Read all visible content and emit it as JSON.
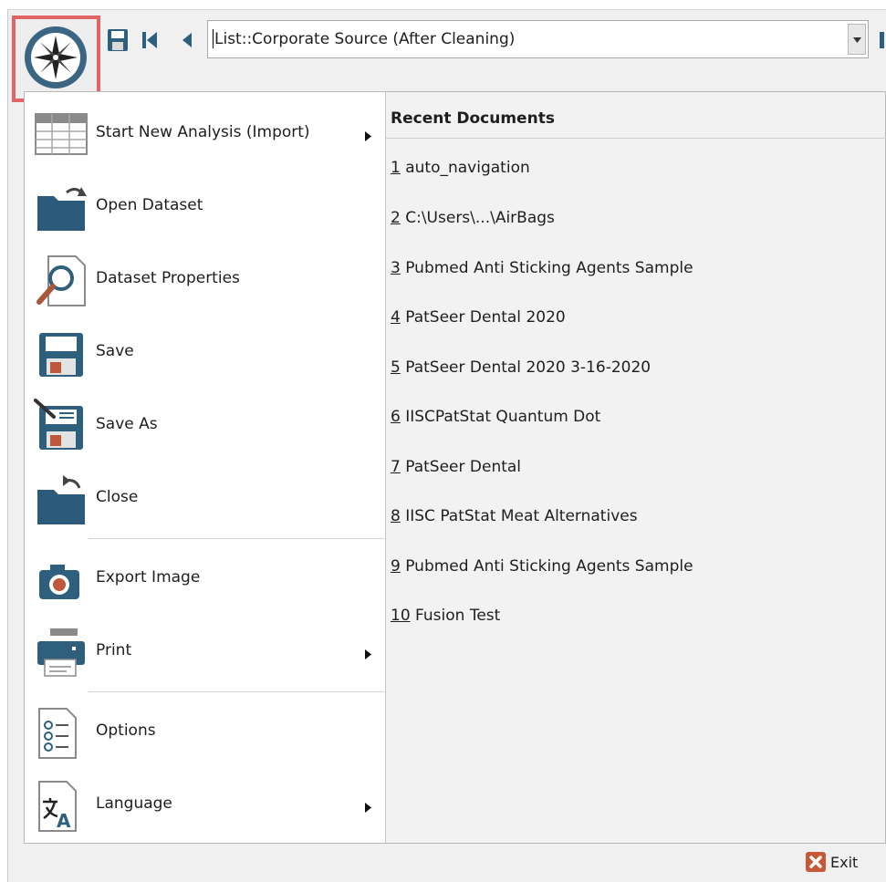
{
  "toolbar": {
    "source_value": "List::Corporate Source (After Cleaning)",
    "icons": [
      "compass-icon",
      "save-icon",
      "first-record-icon",
      "previous-record-icon",
      "dropdown-arrow-icon",
      "next-record-icon"
    ]
  },
  "menu": {
    "items": [
      {
        "label": "Start New Analysis (Import)",
        "icon": "table-icon",
        "submenu": true
      },
      {
        "label": "Open Dataset",
        "icon": "open-folder-icon",
        "submenu": false
      },
      {
        "label": "Dataset Properties",
        "icon": "magnifier-document-icon",
        "submenu": false
      },
      {
        "label": "Save",
        "icon": "floppy-disk-icon",
        "submenu": false
      },
      {
        "label": "Save As",
        "icon": "floppy-pen-icon",
        "submenu": false
      },
      {
        "label": "Close",
        "icon": "close-folder-icon",
        "submenu": false
      },
      {
        "label": "Export Image",
        "icon": "camera-icon",
        "submenu": false
      },
      {
        "label": "Print",
        "icon": "printer-icon",
        "submenu": true
      },
      {
        "label": "Options",
        "icon": "options-list-icon",
        "submenu": false
      },
      {
        "label": "Language",
        "icon": "language-icon",
        "submenu": true
      }
    ]
  },
  "recent": {
    "header": "Recent Documents",
    "items": [
      {
        "num": "1",
        "name": " auto_navigation"
      },
      {
        "num": "2",
        "name": " C:\\Users\\...\\AirBags"
      },
      {
        "num": "3",
        "name": " Pubmed Anti Sticking Agents Sample"
      },
      {
        "num": "4",
        "name": " PatSeer Dental 2020"
      },
      {
        "num": "5",
        "name": " PatSeer Dental 2020 3-16-2020"
      },
      {
        "num": "6",
        "name": " IISCPatStat Quantum Dot"
      },
      {
        "num": "7",
        "name": " PatSeer Dental"
      },
      {
        "num": "8",
        "name": " IISC PatStat Meat Alternatives"
      },
      {
        "num": "9",
        "name": " Pubmed Anti Sticking Agents Sample"
      },
      {
        "num": "10",
        "name": " Fusion Test"
      }
    ]
  },
  "footer": {
    "exit_label": "Exit"
  },
  "colors": {
    "accent": "#2e5f7d",
    "highlight_border": "#e06666",
    "folder": "#2c5a7a",
    "disk_red": "#c0563a",
    "exit_red": "#c65a38"
  }
}
